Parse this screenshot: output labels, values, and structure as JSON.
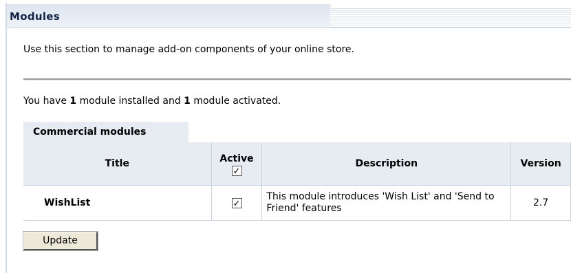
{
  "header": {
    "title": "Modules"
  },
  "intro_text": "Use this section to manage add-on components of your online store.",
  "summary": {
    "prefix": "You have ",
    "installed_count": "1",
    "middle": " module installed and ",
    "activated_count": "1",
    "suffix": " module activated."
  },
  "section_tab": "Commercial modules",
  "table": {
    "columns": {
      "title": "Title",
      "active": "Active",
      "description": "Description",
      "version": "Version"
    },
    "select_all_checked": true,
    "rows": [
      {
        "title": "WishList",
        "active": true,
        "description": "This module introduces 'Wish List' and 'Send to Friend' features",
        "version": "2.7"
      }
    ]
  },
  "update_button": "Update"
}
